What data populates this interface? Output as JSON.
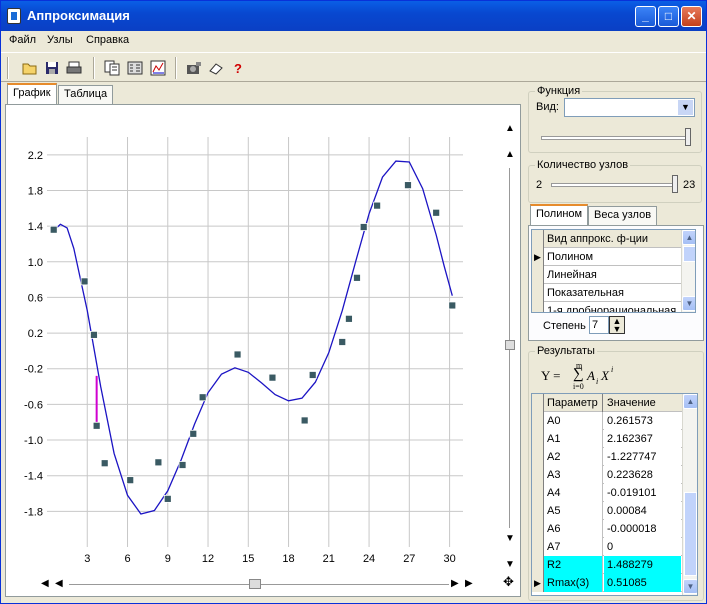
{
  "window": {
    "title": "Аппроксимация",
    "minimize": "_",
    "maximize": "□",
    "close": "✕"
  },
  "menu": [
    "Файл",
    "Узлы",
    "Справка"
  ],
  "toolbar_icons": [
    "open-icon",
    "save-icon",
    "print-icon",
    "copy-icon",
    "calculate-icon",
    "graph-icon",
    "camera-icon",
    "eraser-icon",
    "help-icon"
  ],
  "tabs": [
    "График",
    "Таблица"
  ],
  "function_group": {
    "label": "Функция",
    "kind_label": "Вид:",
    "kind_value": ""
  },
  "nodes_group": {
    "label": "Количество узлов",
    "min": "2",
    "max": "23",
    "value": 23
  },
  "inner_tabs": [
    "Полином",
    "Веса узлов"
  ],
  "approx_list": {
    "header": "Вид аппрокс. ф-ции",
    "items": [
      "Полином",
      "Линейная",
      "Показательная",
      "1-я дробнорациональная"
    ],
    "selected": 0
  },
  "degree": {
    "label": "Степень",
    "value": "7"
  },
  "results_group": {
    "label": "Результаты",
    "formula": {
      "lhs": "Y =",
      "top": "m",
      "bottom": "i=0",
      "term": "A",
      "sub": "i",
      "var": "X",
      "sup": "i"
    },
    "columns": [
      "Параметр",
      "Значение"
    ],
    "rows": [
      {
        "param": "A0",
        "value": "0.261573"
      },
      {
        "param": "A1",
        "value": "2.162367"
      },
      {
        "param": "A2",
        "value": "-1.227747"
      },
      {
        "param": "A3",
        "value": "0.223628"
      },
      {
        "param": "A4",
        "value": "-0.019101"
      },
      {
        "param": "A5",
        "value": "0.00084"
      },
      {
        "param": "A6",
        "value": "-0.000018"
      },
      {
        "param": "A7",
        "value": "0"
      },
      {
        "param": "R2",
        "value": "1.488279",
        "highlight": true
      },
      {
        "param": "Rmax(3)",
        "value": "0.51085",
        "highlight": true,
        "current": true
      }
    ]
  },
  "chart_data": {
    "type": "scatter",
    "title": "",
    "xlabel": "",
    "ylabel": "",
    "xlim": [
      0,
      31
    ],
    "ylim": [
      -2.2,
      2.4
    ],
    "xticks": [
      3,
      6,
      9,
      12,
      15,
      18,
      21,
      24,
      27,
      30
    ],
    "yticks": [
      2.2,
      1.8,
      1.4,
      1.0,
      0.6,
      0.2,
      -0.2,
      -0.6,
      -1.0,
      -1.4,
      -1.8
    ],
    "ytick_labels": [
      "2.2",
      "1.8",
      "1.4",
      "1.0",
      "0.6",
      "0.2",
      "-0.2",
      "-0.6",
      "-1.0",
      "-1.4",
      "-1.8"
    ],
    "grid": true,
    "points": [
      {
        "x": 0.5,
        "y": 1.36
      },
      {
        "x": 2.8,
        "y": 0.78
      },
      {
        "x": 3.5,
        "y": 0.18
      },
      {
        "x": 3.7,
        "y": -0.84
      },
      {
        "x": 4.3,
        "y": -1.26
      },
      {
        "x": 6.2,
        "y": -1.45
      },
      {
        "x": 8.3,
        "y": -1.25
      },
      {
        "x": 9.0,
        "y": -1.66
      },
      {
        "x": 10.1,
        "y": -1.28
      },
      {
        "x": 10.9,
        "y": -0.93
      },
      {
        "x": 11.6,
        "y": -0.52
      },
      {
        "x": 14.2,
        "y": -0.04
      },
      {
        "x": 16.8,
        "y": -0.3
      },
      {
        "x": 19.2,
        "y": -0.78
      },
      {
        "x": 19.8,
        "y": -0.27
      },
      {
        "x": 22.0,
        "y": 0.1
      },
      {
        "x": 22.5,
        "y": 0.36
      },
      {
        "x": 23.1,
        "y": 0.82
      },
      {
        "x": 23.6,
        "y": 1.39
      },
      {
        "x": 24.6,
        "y": 1.63
      },
      {
        "x": 26.9,
        "y": 1.86
      },
      {
        "x": 29.0,
        "y": 1.55
      },
      {
        "x": 30.2,
        "y": 0.51
      }
    ],
    "curve": [
      {
        "x": 0.5,
        "y": 1.35
      },
      {
        "x": 1.0,
        "y": 1.42
      },
      {
        "x": 1.5,
        "y": 1.38
      },
      {
        "x": 2.0,
        "y": 1.15
      },
      {
        "x": 3.0,
        "y": 0.45
      },
      {
        "x": 4.0,
        "y": -0.4
      },
      {
        "x": 5.0,
        "y": -1.15
      },
      {
        "x": 6.0,
        "y": -1.62
      },
      {
        "x": 7.0,
        "y": -1.83
      },
      {
        "x": 8.0,
        "y": -1.79
      },
      {
        "x": 9.0,
        "y": -1.57
      },
      {
        "x": 10.0,
        "y": -1.22
      },
      {
        "x": 11.0,
        "y": -0.82
      },
      {
        "x": 12.0,
        "y": -0.47
      },
      {
        "x": 13.0,
        "y": -0.26
      },
      {
        "x": 14.0,
        "y": -0.19
      },
      {
        "x": 15.0,
        "y": -0.24
      },
      {
        "x": 16.0,
        "y": -0.36
      },
      {
        "x": 17.0,
        "y": -0.49
      },
      {
        "x": 18.0,
        "y": -0.56
      },
      {
        "x": 19.0,
        "y": -0.53
      },
      {
        "x": 20.0,
        "y": -0.35
      },
      {
        "x": 21.0,
        "y": -0.02
      },
      {
        "x": 22.0,
        "y": 0.45
      },
      {
        "x": 23.0,
        "y": 1.0
      },
      {
        "x": 24.0,
        "y": 1.54
      },
      {
        "x": 25.0,
        "y": 1.95
      },
      {
        "x": 26.0,
        "y": 2.13
      },
      {
        "x": 27.0,
        "y": 2.12
      },
      {
        "x": 28.0,
        "y": 1.82
      },
      {
        "x": 29.0,
        "y": 1.3
      },
      {
        "x": 29.6,
        "y": 0.95
      },
      {
        "x": 30.2,
        "y": 0.62
      }
    ],
    "residual": {
      "x": 3.7,
      "y_from": -0.28,
      "y_to": -0.84
    },
    "colors": {
      "curve": "#1c14c4",
      "point": "#3a5a63",
      "residual": "#d000d0",
      "grid": "#c8c8c8"
    }
  }
}
